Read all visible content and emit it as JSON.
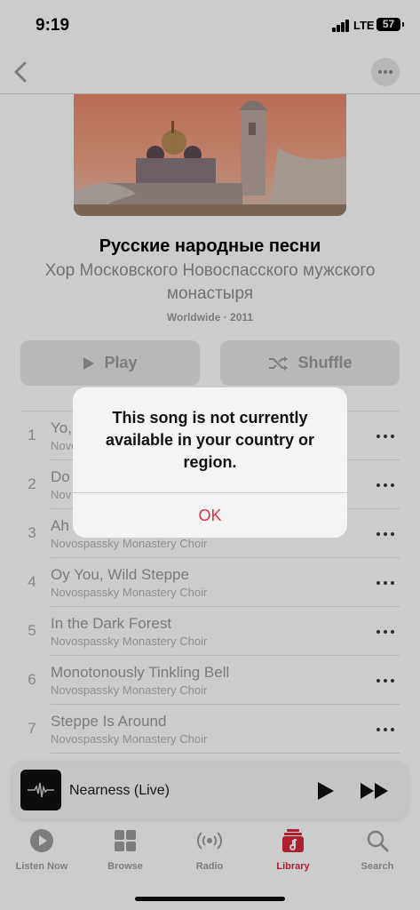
{
  "status_bar": {
    "time": "9:19",
    "network": "LTE",
    "battery": "57"
  },
  "album": {
    "title": "Русские народные песни",
    "artist": "Хор Московского Новоспасского мужского монастыря",
    "meta": "Worldwide · 2011"
  },
  "actions": {
    "play_label": "Play",
    "shuffle_label": "Shuffle"
  },
  "tracks": [
    {
      "number": "1",
      "title": "Yo,",
      "artist": "Novo"
    },
    {
      "number": "2",
      "title": "Do",
      "artist": "Nov"
    },
    {
      "number": "3",
      "title": "Ah",
      "artist": "Novospassky Monastery Choir"
    },
    {
      "number": "4",
      "title": "Oy You, Wild Steppe",
      "artist": "Novospassky Monastery Choir"
    },
    {
      "number": "5",
      "title": "In the Dark Forest",
      "artist": "Novospassky Monastery Choir"
    },
    {
      "number": "6",
      "title": "Monotonously Tinkling Bell",
      "artist": "Novospassky Monastery Choir"
    },
    {
      "number": "7",
      "title": "Steppe Is Around",
      "artist": "Novospassky Monastery Choir"
    }
  ],
  "alert": {
    "message": "This song is not currently available in your country or region.",
    "ok_label": "OK"
  },
  "mini_player": {
    "title": "Nearness (Live)"
  },
  "tabs": [
    {
      "label": "Listen Now",
      "icon": "play-circle-icon"
    },
    {
      "label": "Browse",
      "icon": "grid-icon"
    },
    {
      "label": "Radio",
      "icon": "radio-waves-icon"
    },
    {
      "label": "Library",
      "icon": "music-library-icon",
      "active": true
    },
    {
      "label": "Search",
      "icon": "search-icon"
    }
  ],
  "colors": {
    "accent": "#d8283d",
    "alert_button": "#e03042"
  }
}
